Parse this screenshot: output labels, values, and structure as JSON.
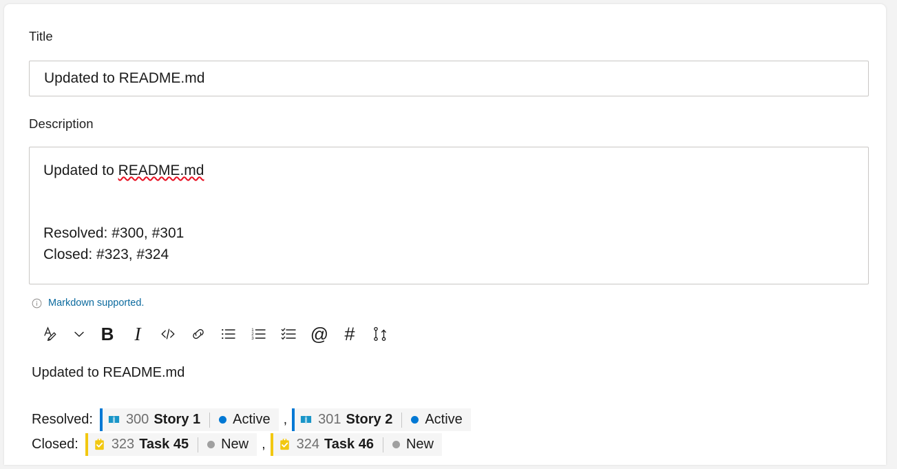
{
  "form": {
    "title_label": "Title",
    "title_value": "Updated to README.md",
    "description_label": "Description",
    "description_line1_prefix": "Updated to ",
    "description_line1_misspelled": "README.md",
    "description_line2": "Resolved: #300, #301",
    "description_line3": "Closed: #323, #324"
  },
  "markdown_note": {
    "icon": "info-icon",
    "text": "Markdown supported."
  },
  "toolbar": {
    "items": [
      {
        "name": "font-style-icon",
        "label": "Font style"
      },
      {
        "name": "chevron-down-icon",
        "label": "More font options"
      },
      {
        "name": "bold-icon",
        "label": "B"
      },
      {
        "name": "italic-icon",
        "label": "I"
      },
      {
        "name": "code-icon",
        "label": "</>"
      },
      {
        "name": "link-icon",
        "label": "Link"
      },
      {
        "name": "bulleted-list-icon",
        "label": "Bulleted list"
      },
      {
        "name": "numbered-list-icon",
        "label": "Numbered list"
      },
      {
        "name": "checklist-icon",
        "label": "Checklist"
      },
      {
        "name": "mention-icon",
        "label": "@"
      },
      {
        "name": "hashtag-icon",
        "label": "#"
      },
      {
        "name": "pull-request-icon",
        "label": "Link pull request"
      }
    ]
  },
  "preview": {
    "heading": "Updated to README.md",
    "rows": [
      {
        "label": "Resolved:",
        "separator": ",",
        "chips": [
          {
            "type": "story",
            "icon": "story-book-icon",
            "id": "300",
            "title": "Story 1",
            "state": "Active",
            "state_color": "#0078d4",
            "accent": "#0078d4"
          },
          {
            "type": "story",
            "icon": "story-book-icon",
            "id": "301",
            "title": "Story 2",
            "state": "Active",
            "state_color": "#0078d4",
            "accent": "#0078d4"
          }
        ]
      },
      {
        "label": "Closed:",
        "separator": ",",
        "chips": [
          {
            "type": "task",
            "icon": "task-clipboard-icon",
            "id": "323",
            "title": "Task 45",
            "state": "New",
            "state_color": "#a0a0a0",
            "accent": "#f2c811"
          },
          {
            "type": "task",
            "icon": "task-clipboard-icon",
            "id": "324",
            "title": "Task 46",
            "state": "New",
            "state_color": "#a0a0a0",
            "accent": "#f2c811"
          }
        ]
      }
    ]
  },
  "colors": {
    "accent_blue": "#0078d4",
    "task_yellow": "#f2c811",
    "link_blue": "#0b6a9e",
    "chip_bg": "#f5f5f5",
    "border": "#c8c6c4"
  }
}
